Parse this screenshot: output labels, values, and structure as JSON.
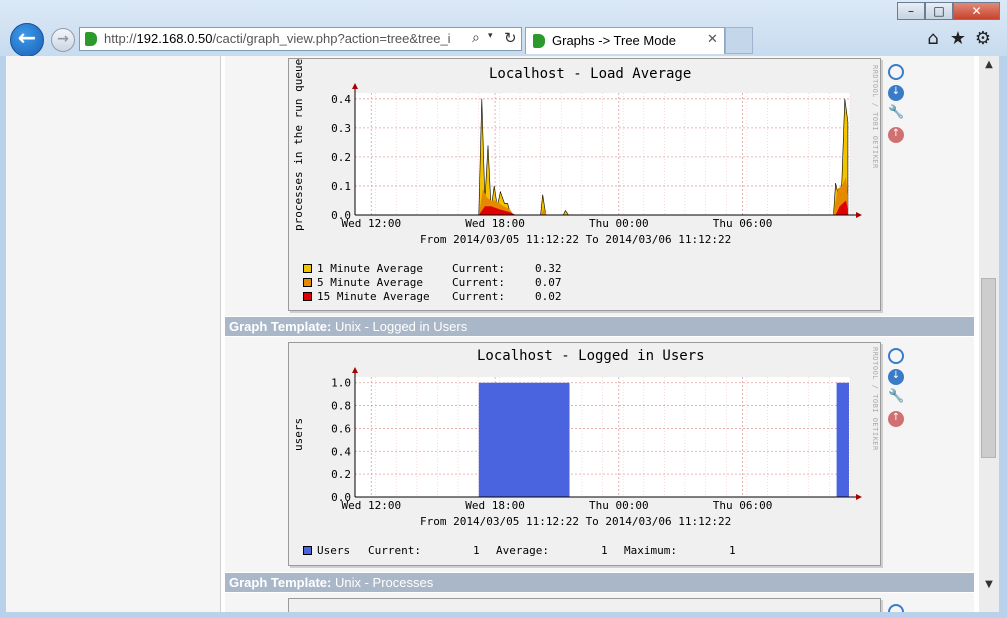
{
  "browser": {
    "url_prefix": "http://",
    "url_host": "192.168.0.50",
    "url_path": "/cacti/graph_view.php?action=tree&tree_i",
    "tab_title": "Graphs -> Tree Mode",
    "window_controls": [
      "minimize",
      "maximize",
      "close"
    ],
    "icons": {
      "back": "back-arrow-icon",
      "forward": "forward-arrow-icon",
      "search": "search-icon",
      "refresh": "refresh-icon",
      "home": "home-icon",
      "favorites": "star-icon",
      "tools": "gear-icon"
    }
  },
  "graphs": [
    {
      "title": "Localhost - Load Average",
      "ylabel": "processes in the run queue",
      "time_range": "From 2014/03/05 11:12:22 To 2014/03/06 11:12:22",
      "legend": [
        {
          "label": "1 Minute Average",
          "current_label": "Current:",
          "current": "0.32",
          "color": "#f2c400"
        },
        {
          "label": "5 Minute Average",
          "current_label": "Current:",
          "current": "0.07",
          "color": "#e58a00"
        },
        {
          "label": "15 Minute Average",
          "current_label": "Current:",
          "current": "0.02",
          "color": "#e00000"
        }
      ]
    },
    {
      "template_label": "Graph Template:",
      "template_name": "Unix - Logged in Users",
      "title": "Localhost - Logged in Users",
      "ylabel": "users",
      "time_range": "From 2014/03/05 11:12:22 To 2014/03/06 11:12:22",
      "legend": [
        {
          "label": "Users",
          "current_label": "Current:",
          "current": "1",
          "average_label": "Average:",
          "average": "1",
          "maximum_label": "Maximum:",
          "maximum": "1",
          "color": "#4a63de"
        }
      ]
    },
    {
      "template_label": "Graph Template:",
      "template_name": "Unix - Processes"
    }
  ],
  "rrdtool_credit": "RRDTOOL / TOBI OETIKER",
  "chart_data": [
    {
      "type": "area",
      "title": "Localhost - Load Average",
      "ylabel": "processes in the run queue",
      "x_tick_labels": [
        "Wed 12:00",
        "Wed 18:00",
        "Thu 00:00",
        "Thu 06:00"
      ],
      "y_tick_labels": [
        "0.0",
        "0.1",
        "0.2",
        "0.3",
        "0.4"
      ],
      "ylim": [
        0,
        0.42
      ],
      "x_unit": "hours since 2014/03/05 11:12:22",
      "xlim": [
        0,
        24
      ],
      "grid": true,
      "series": [
        {
          "name": "1 Minute Average",
          "color": "#f2c400",
          "points": [
            [
              6.0,
              0
            ],
            [
              6.15,
              0.4
            ],
            [
              6.3,
              0.05
            ],
            [
              6.45,
              0.24
            ],
            [
              6.6,
              0.02
            ],
            [
              6.75,
              0.1
            ],
            [
              6.9,
              0.03
            ],
            [
              7.05,
              0.08
            ],
            [
              7.25,
              0.04
            ],
            [
              7.4,
              0.04
            ],
            [
              7.55,
              0
            ],
            [
              9.0,
              0
            ],
            [
              9.1,
              0.07
            ],
            [
              9.25,
              0
            ],
            [
              10.1,
              0
            ],
            [
              10.2,
              0.015
            ],
            [
              10.35,
              0
            ],
            [
              23.2,
              0
            ],
            [
              23.3,
              0.11
            ],
            [
              23.45,
              0.06
            ],
            [
              23.6,
              0.11
            ],
            [
              23.75,
              0.4
            ],
            [
              23.9,
              0.32
            ]
          ]
        },
        {
          "name": "5 Minute Average",
          "color": "#e58a00",
          "points": [
            [
              6.0,
              0
            ],
            [
              6.2,
              0.09
            ],
            [
              6.4,
              0.06
            ],
            [
              6.6,
              0.05
            ],
            [
              6.8,
              0.05
            ],
            [
              7.0,
              0.04
            ],
            [
              7.2,
              0.03
            ],
            [
              7.5,
              0.02
            ],
            [
              7.7,
              0
            ],
            [
              9.0,
              0
            ],
            [
              9.15,
              0.02
            ],
            [
              9.3,
              0
            ],
            [
              23.2,
              0
            ],
            [
              23.4,
              0.09
            ],
            [
              23.6,
              0.1
            ],
            [
              23.8,
              0.13
            ],
            [
              23.9,
              0.07
            ]
          ]
        },
        {
          "name": "15 Minute Average",
          "color": "#e00000",
          "points": [
            [
              6.0,
              0
            ],
            [
              6.3,
              0.03
            ],
            [
              6.6,
              0.03
            ],
            [
              7.0,
              0.02
            ],
            [
              7.5,
              0.01
            ],
            [
              7.8,
              0
            ],
            [
              23.3,
              0
            ],
            [
              23.5,
              0.03
            ],
            [
              23.8,
              0.05
            ],
            [
              23.9,
              0.02
            ]
          ]
        }
      ]
    },
    {
      "type": "area",
      "title": "Localhost - Logged in Users",
      "ylabel": "users",
      "x_tick_labels": [
        "Wed 12:00",
        "Wed 18:00",
        "Thu 00:00",
        "Thu 06:00"
      ],
      "y_tick_labels": [
        "0.0",
        "0.2",
        "0.4",
        "0.6",
        "0.8",
        "1.0"
      ],
      "ylim": [
        0,
        1.05
      ],
      "x_unit": "hours since 2014/03/05 11:12:22",
      "xlim": [
        0,
        24
      ],
      "grid": true,
      "series": [
        {
          "name": "Users",
          "color": "#4a63de",
          "points": [
            [
              6.0,
              0
            ],
            [
              6.0,
              1
            ],
            [
              10.4,
              1
            ],
            [
              10.4,
              0
            ],
            [
              23.35,
              0
            ],
            [
              23.35,
              1
            ],
            [
              23.95,
              1
            ],
            [
              23.95,
              0
            ]
          ]
        }
      ]
    }
  ]
}
